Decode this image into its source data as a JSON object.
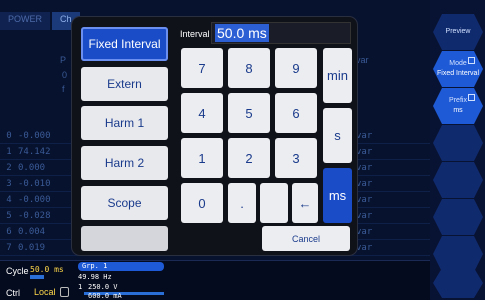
{
  "background": {
    "tabs": [
      "POWER",
      "Ch"
    ],
    "rows": [
      {
        "idx": "0",
        "val": "-0.000"
      },
      {
        "idx": "1",
        "val": "74.142"
      },
      {
        "idx": "2",
        "val": "0.000"
      },
      {
        "idx": "3",
        "val": "-0.010"
      },
      {
        "idx": "4",
        "val": "-0.000"
      },
      {
        "idx": "5",
        "val": "-0.028"
      },
      {
        "idx": "6",
        "val": "0.004"
      },
      {
        "idx": "7",
        "val": "0.019"
      }
    ],
    "row_unit": "var",
    "side_labels": [
      "P",
      "0",
      "f"
    ]
  },
  "right_panel": {
    "preview": "Preview",
    "mode_title": "Mode",
    "mode_value": "Fixed Interval",
    "prefix_title": "Prefix",
    "prefix_value": "ms"
  },
  "status": {
    "cycle_label": "Cycle",
    "cycle_value": "50.0 ms",
    "ctrl_label": "Ctrl",
    "ctrl_value": "Local",
    "group": "Grp. 1",
    "freq": "49.98  Hz",
    "voltage": "250.0 V",
    "current": "600.0 mA",
    "meter_prefix": "1"
  },
  "dialog": {
    "modes": [
      "Fixed Interval",
      "Extern",
      "Harm 1",
      "Harm 2",
      "Scope"
    ],
    "interval_label": "Interval",
    "interval_value": "50.0 ms",
    "keys": [
      "7",
      "8",
      "9",
      "4",
      "5",
      "6",
      "1",
      "2",
      "3",
      "0",
      ".",
      "",
      "←"
    ],
    "units": [
      "min",
      "s",
      "ms"
    ],
    "cancel": "Cancel"
  }
}
